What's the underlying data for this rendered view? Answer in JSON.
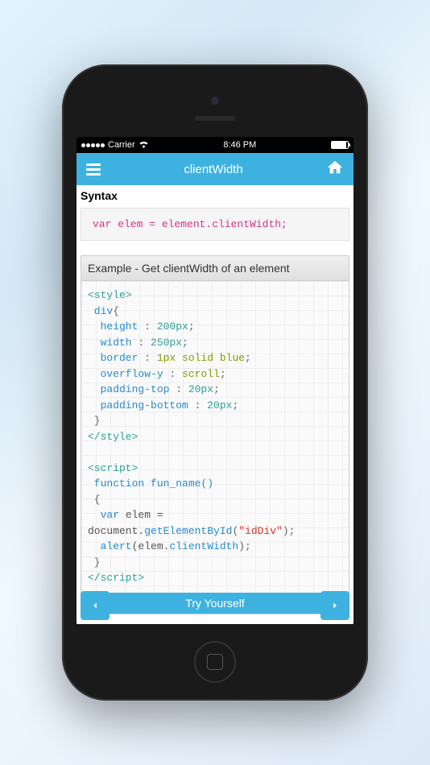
{
  "status_bar": {
    "carrier": "Carrier",
    "time": "8:46 PM"
  },
  "nav": {
    "title": "clientWidth"
  },
  "syntax": {
    "heading": "Syntax",
    "code_kw": "var",
    "code_rest": " elem = element.clientWidth;"
  },
  "example": {
    "title": "Example - Get clientWidth of an element",
    "code_lines": {
      "l1a": "<style>",
      "l2": " div",
      "l2b": "{",
      "l3a": "  height",
      "l3b": " : ",
      "l3c": "200px",
      "l3d": ";",
      "l4a": "  width",
      "l4b": " : ",
      "l4c": "250px",
      "l4d": ";",
      "l5a": "  border",
      "l5b": " : ",
      "l5c": "1px solid blue",
      "l5d": ";",
      "l6a": "  overflow-y",
      "l6b": " : ",
      "l6c": "scroll",
      "l6d": ";",
      "l7a": "  padding-top",
      "l7b": " : ",
      "l7c": "20px",
      "l7d": ";",
      "l8a": "  padding-bottom",
      "l8b": " : ",
      "l8c": "20px",
      "l8d": ";",
      "l9": " }",
      "l10": "</style>",
      "l12": "<script>",
      "l13a": " function",
      "l13b": " fun_name()",
      "l14": " {",
      "l15a": "  var",
      "l15b": " elem = ",
      "l16a": "document.",
      "l16b": "getElementById",
      "l16c": "(",
      "l16d": "\"idDiv\"",
      "l16e": ");",
      "l17a": "  alert",
      "l17b": "(elem.",
      "l17c": "clientWidth",
      "l17d": ");",
      "l18": " }",
      "l19": "</script>"
    },
    "button": "Try Yourself"
  }
}
